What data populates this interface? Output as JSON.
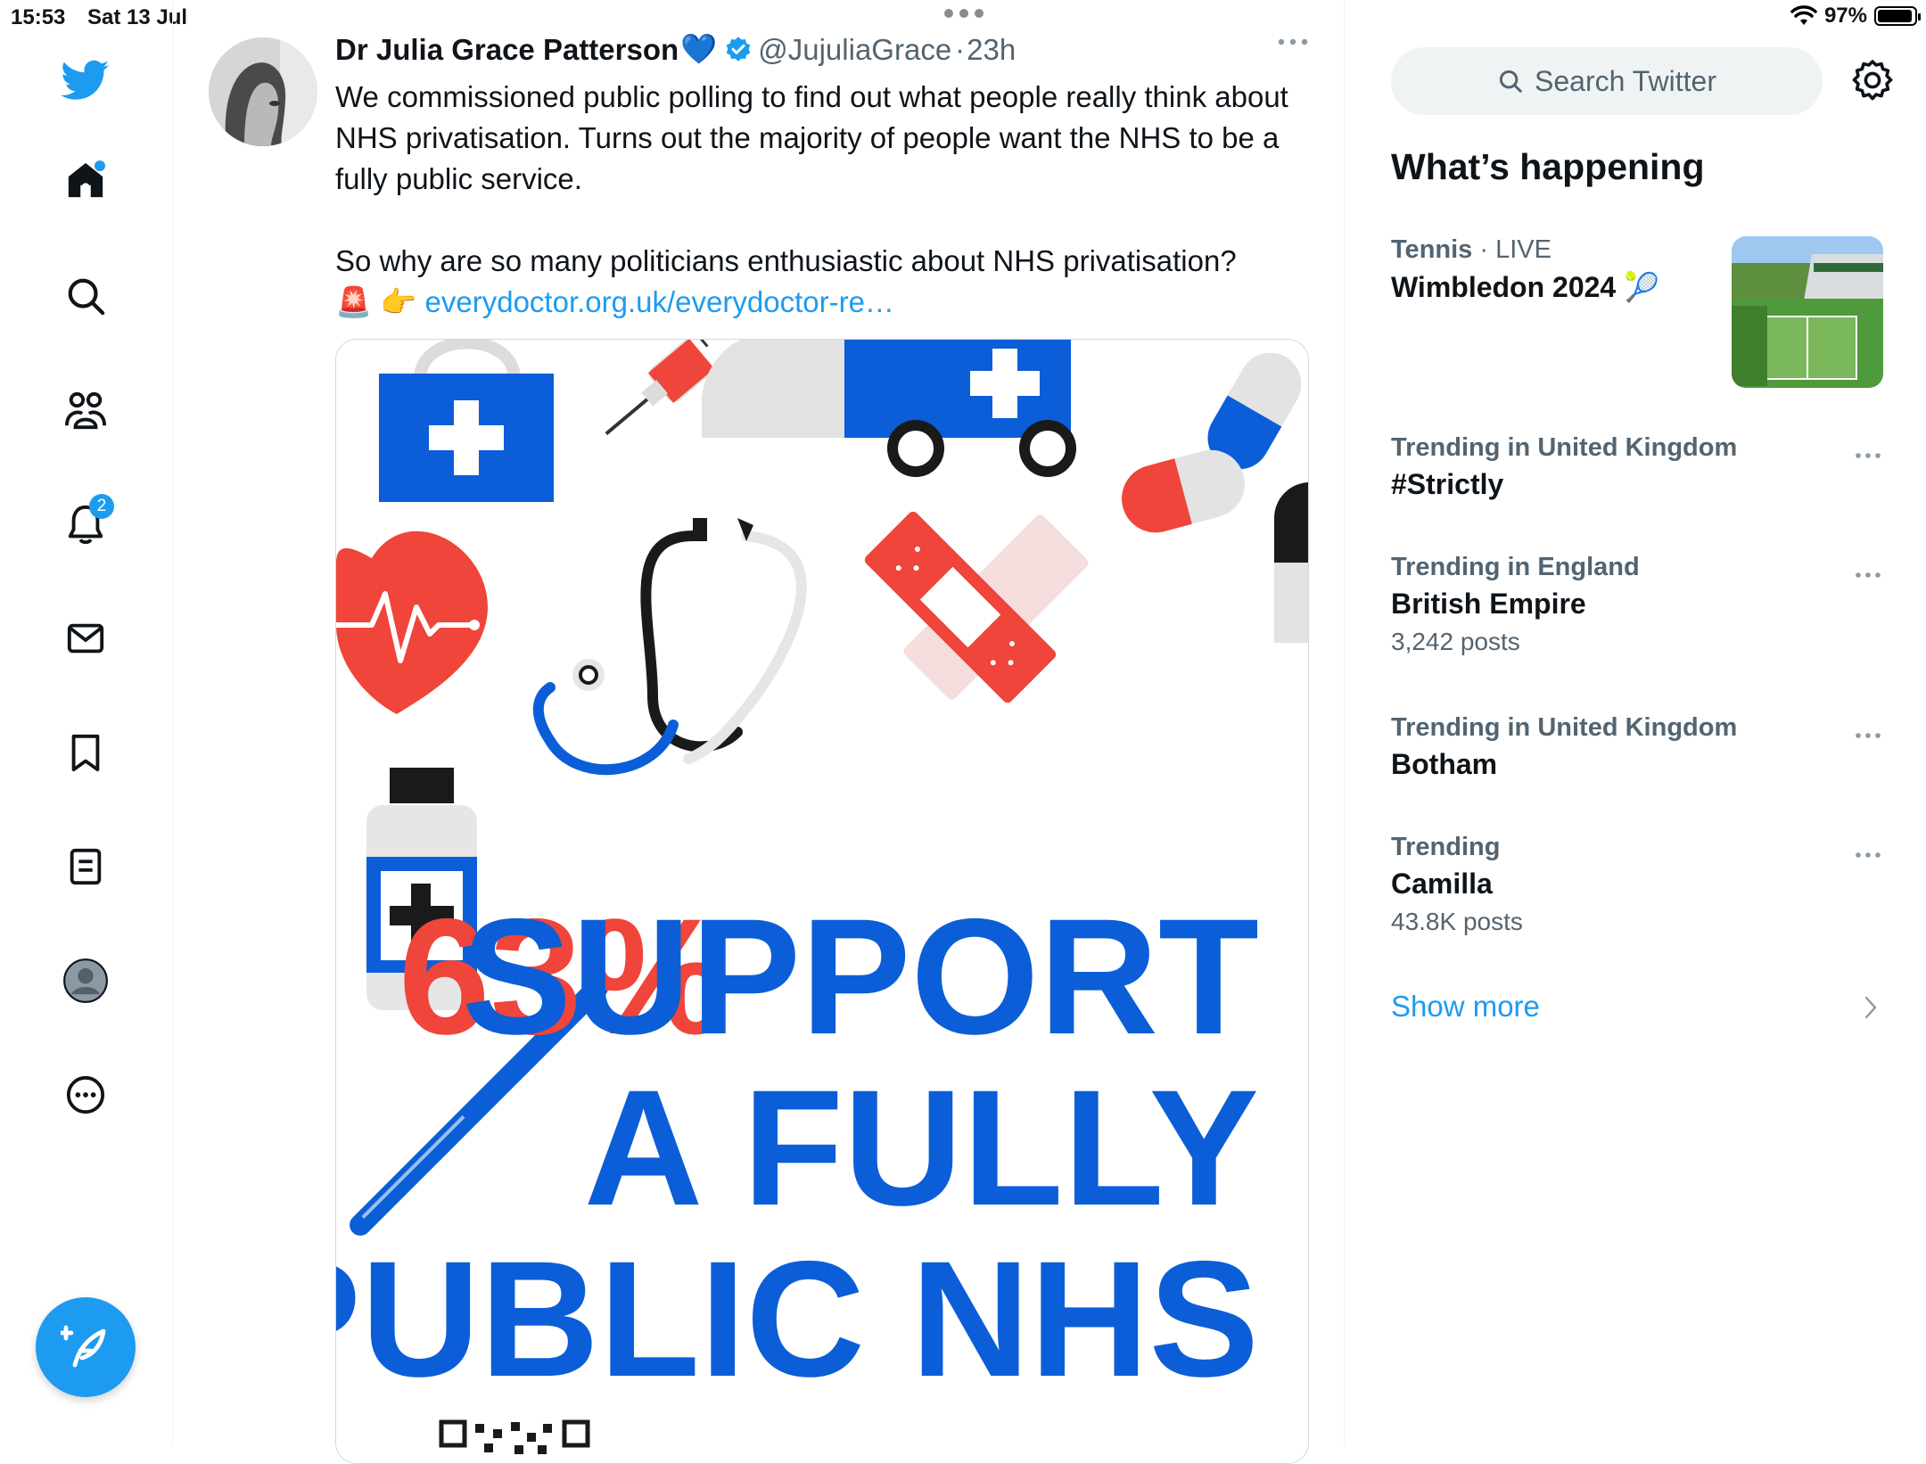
{
  "status_bar": {
    "time": "15:53",
    "date": "Sat 13 Jul",
    "battery": "97%"
  },
  "left_nav": {
    "items": [
      {
        "name": "home-icon"
      },
      {
        "name": "search-icon"
      },
      {
        "name": "communities-icon"
      },
      {
        "name": "notifications-icon",
        "badge": "2"
      },
      {
        "name": "messages-icon"
      },
      {
        "name": "bookmarks-icon"
      },
      {
        "name": "lists-icon"
      },
      {
        "name": "profile-icon"
      },
      {
        "name": "more-icon"
      }
    ],
    "accent": "#1d9bf0"
  },
  "tweet": {
    "author_name": "Dr Julia Grace Patterson",
    "name_emoji": "💙",
    "handle": "@JujuliaGrace",
    "separator": "·",
    "time": "23h",
    "paragraph1": "We commissioned public polling to find out what people really think about NHS privatisation. Turns out the majority of people want the NHS to be a fully public service.",
    "paragraph2": "So why are so many politicians enthusiastic about NHS privatisation?",
    "link_emoji": "🚨 👉",
    "link": "everydoctor.org.uk/everydoctor-re…",
    "image": {
      "stat": "63%",
      "line1": "SUPPORT",
      "line2": "A FULLY",
      "line3": "PUBLIC NHS"
    }
  },
  "right_column": {
    "search_placeholder": "Search Twitter",
    "section_title": "What’s happening",
    "trends": [
      {
        "context": "Tennis",
        "live": "· LIVE",
        "title": "Wimbledon 2024",
        "emoji": "🎾"
      },
      {
        "context": "Trending in United Kingdom",
        "title": "#Strictly"
      },
      {
        "context": "Trending in England",
        "title": "British Empire",
        "count": "3,242 posts"
      },
      {
        "context": "Trending in United Kingdom",
        "title": "Botham"
      },
      {
        "context": "Trending",
        "title": "Camilla",
        "count": "43.8K posts"
      }
    ],
    "show_more": "Show more"
  },
  "colors": {
    "nhs_blue": "#0b5ed7",
    "red": "#f0453a",
    "twitter_blue": "#1d9bf0"
  }
}
